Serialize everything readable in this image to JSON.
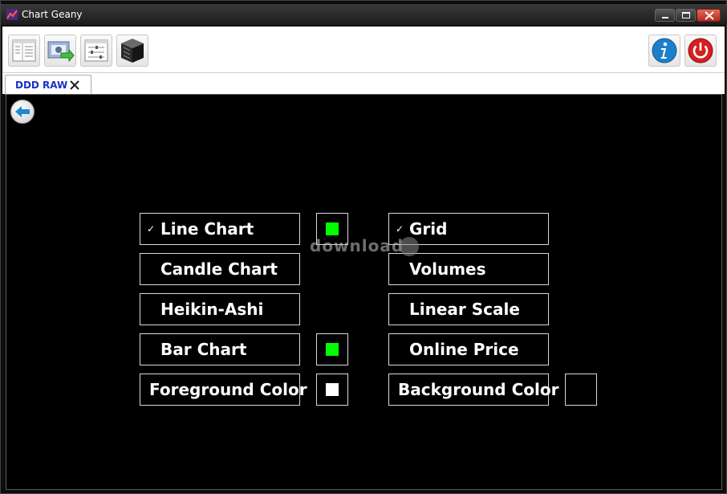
{
  "window": {
    "title": "Chart Geany"
  },
  "tab": {
    "label": "DDD RAW"
  },
  "watermark": {
    "text": "download"
  },
  "options": [
    {
      "label": "Line Chart",
      "checked": true,
      "check_glyph": "✓",
      "swatch": "#00ff00"
    },
    {
      "label": "Candle Chart",
      "checked": false,
      "check_glyph": "",
      "swatch": null
    },
    {
      "label": "Heikin-Ashi",
      "checked": false,
      "check_glyph": "",
      "swatch": null
    },
    {
      "label": "Bar Chart",
      "checked": false,
      "check_glyph": "",
      "swatch": "#00ff00"
    },
    {
      "label": "Foreground Color",
      "checked": false,
      "check_glyph": "",
      "swatch": "#ffffff"
    },
    {
      "label": "Grid",
      "checked": true,
      "check_glyph": "✓",
      "swatch": null
    },
    {
      "label": "Volumes",
      "checked": false,
      "check_glyph": "",
      "swatch": null
    },
    {
      "label": "Linear Scale",
      "checked": false,
      "check_glyph": "",
      "swatch": null
    },
    {
      "label": "Online Price",
      "checked": false,
      "check_glyph": "",
      "swatch": null
    },
    {
      "label": "Background Color",
      "checked": false,
      "check_glyph": "",
      "swatch": "#000000"
    }
  ],
  "colors": {
    "accent_green": "#00ff00",
    "tab_text": "#1a32c8",
    "info_blue": "#1d7fc9",
    "power_red": "#d42020"
  },
  "icons": {
    "toolbar": [
      "chart-list-icon",
      "screenshot-export-icon",
      "settings-list-icon",
      "database-cube-icon"
    ],
    "right": [
      "info-icon",
      "power-icon"
    ]
  }
}
